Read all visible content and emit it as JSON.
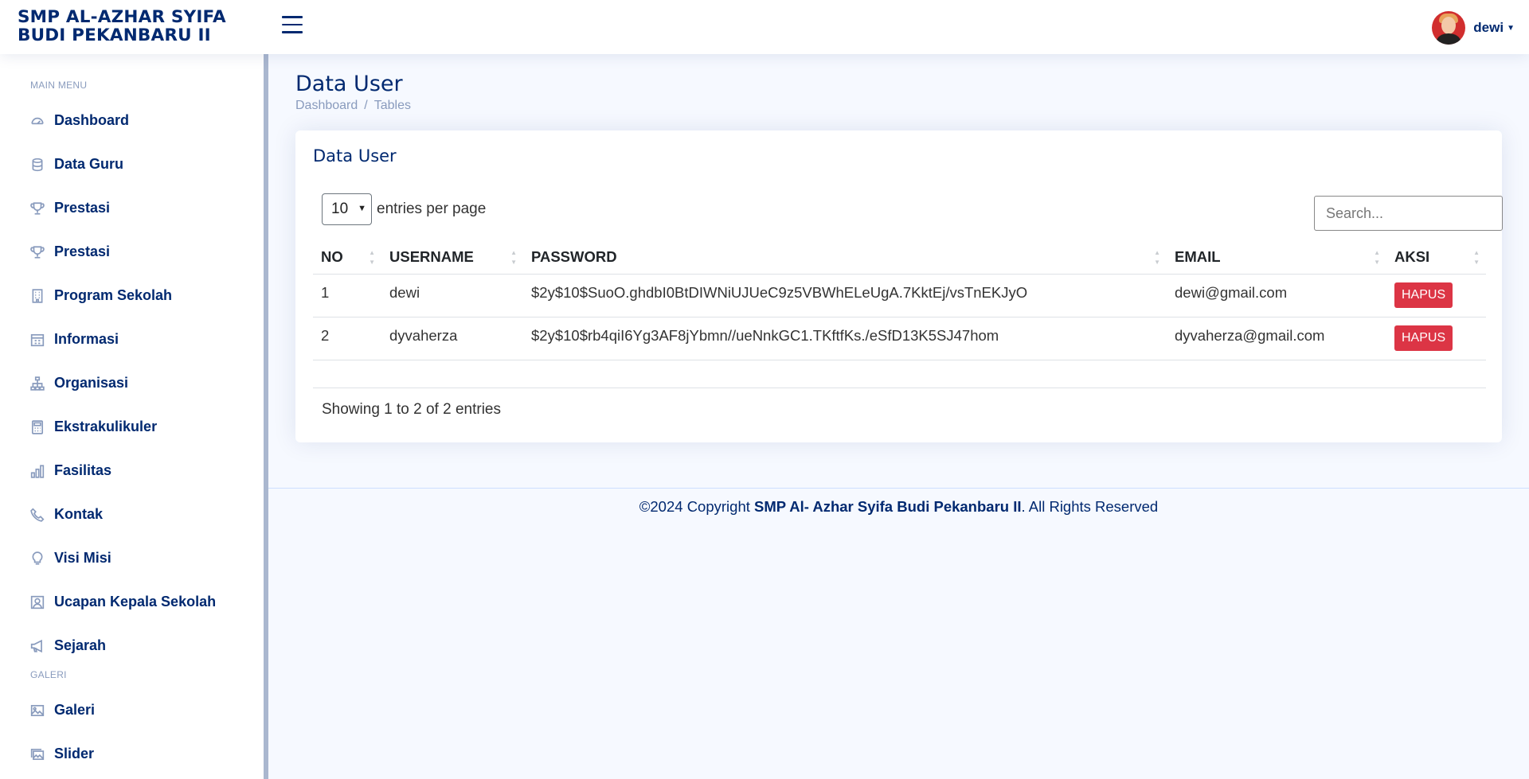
{
  "header": {
    "logo_line1": "SMP AL-AZHAR SYIFA",
    "logo_line2": "BUDI PEKANBARU II",
    "user_name": "dewi"
  },
  "sidebar": {
    "heading_main": "MAIN MENU",
    "heading_gallery": "GALERI",
    "items": [
      {
        "label": "Dashboard",
        "icon": "dashboard-icon"
      },
      {
        "label": "Data Guru",
        "icon": "database-icon"
      },
      {
        "label": "Prestasi",
        "icon": "trophy-icon"
      },
      {
        "label": "Prestasi",
        "icon": "trophy-icon"
      },
      {
        "label": "Program Sekolah",
        "icon": "building-icon"
      },
      {
        "label": "Informasi",
        "icon": "calendar-icon"
      },
      {
        "label": "Organisasi",
        "icon": "diagram-icon"
      },
      {
        "label": "Ekstrakulikuler",
        "icon": "calculator-icon"
      },
      {
        "label": "Fasilitas",
        "icon": "bar-chart-icon"
      },
      {
        "label": "Kontak",
        "icon": "phone-icon"
      },
      {
        "label": "Visi Misi",
        "icon": "lightbulb-icon"
      },
      {
        "label": "Ucapan Kepala Sekolah",
        "icon": "person-square-icon"
      },
      {
        "label": "Sejarah",
        "icon": "megaphone-icon"
      }
    ],
    "gallery_items": [
      {
        "label": "Galeri",
        "icon": "image-icon"
      },
      {
        "label": "Slider",
        "icon": "images-icon"
      }
    ]
  },
  "page": {
    "title": "Data User",
    "breadcrumb": [
      "Dashboard",
      "Tables"
    ],
    "card_title": "Data User"
  },
  "table": {
    "per_page_value": "10",
    "per_page_label": "entries per page",
    "search_placeholder": "Search...",
    "columns": [
      "NO",
      "USERNAME",
      "PASSWORD",
      "EMAIL",
      "AKSI"
    ],
    "rows": [
      {
        "no": "1",
        "username": "dewi",
        "password": "$2y$10$SuoO.ghdbI0BtDIWNiUJUeC9z5VBWhELeUgA.7KktEj/vsTnEKJyO",
        "email": "dewi@gmail.com",
        "action": "HAPUS"
      },
      {
        "no": "2",
        "username": "dyvaherza",
        "password": "$2y$10$rb4qiI6Yg3AF8jYbmn//ueNnkGC1.TKftfKs./eSfD13K5SJ47hom",
        "email": "dyvaherza@gmail.com",
        "action": "HAPUS"
      }
    ],
    "showing": "Showing 1 to 2 of 2 entries"
  },
  "footer": {
    "prefix": "©2024 Copyright ",
    "org": "SMP Al- Azhar Syifa Budi Pekanbaru II",
    "suffix": ". All Rights Reserved"
  },
  "colors": {
    "brand": "#012970",
    "danger": "#dc3545",
    "muted": "#899bbd",
    "background": "#f6f9ff"
  }
}
